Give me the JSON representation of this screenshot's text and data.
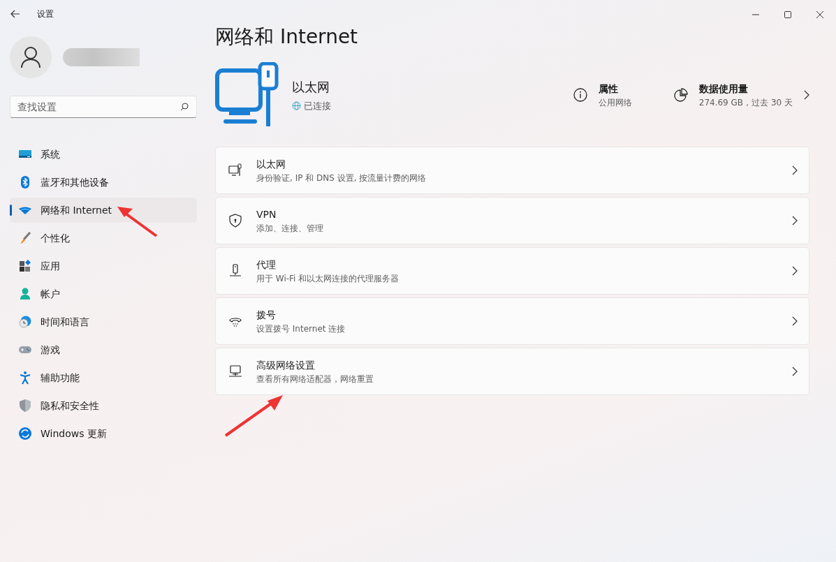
{
  "window": {
    "title": "设置"
  },
  "search": {
    "placeholder": "查找设置"
  },
  "nav": [
    {
      "label": "系统",
      "selected": false
    },
    {
      "label": "蓝牙和其他设备",
      "selected": false
    },
    {
      "label": "网络和 Internet",
      "selected": true
    },
    {
      "label": "个性化",
      "selected": false
    },
    {
      "label": "应用",
      "selected": false
    },
    {
      "label": "帐户",
      "selected": false
    },
    {
      "label": "时间和语言",
      "selected": false
    },
    {
      "label": "游戏",
      "selected": false
    },
    {
      "label": "辅助功能",
      "selected": false
    },
    {
      "label": "隐私和安全性",
      "selected": false
    },
    {
      "label": "Windows 更新",
      "selected": false
    }
  ],
  "page_title": "网络和 Internet",
  "connection": {
    "name": "以太网",
    "status": "已连接"
  },
  "properties": {
    "label": "属性",
    "value": "公用网络"
  },
  "data_usage": {
    "label": "数据使用量",
    "value": "274.69 GB，过去 30 天"
  },
  "settings": [
    {
      "title": "以太网",
      "description": "身份验证, IP 和 DNS 设置, 按流量计费的网络"
    },
    {
      "title": "VPN",
      "description": "添加、连接、管理"
    },
    {
      "title": "代理",
      "description": "用于 Wi-Fi 和以太网连接的代理服务器"
    },
    {
      "title": "拨号",
      "description": "设置拨号 Internet 连接"
    },
    {
      "title": "高级网络设置",
      "description": "查看所有网络适配器，网络重置"
    }
  ]
}
